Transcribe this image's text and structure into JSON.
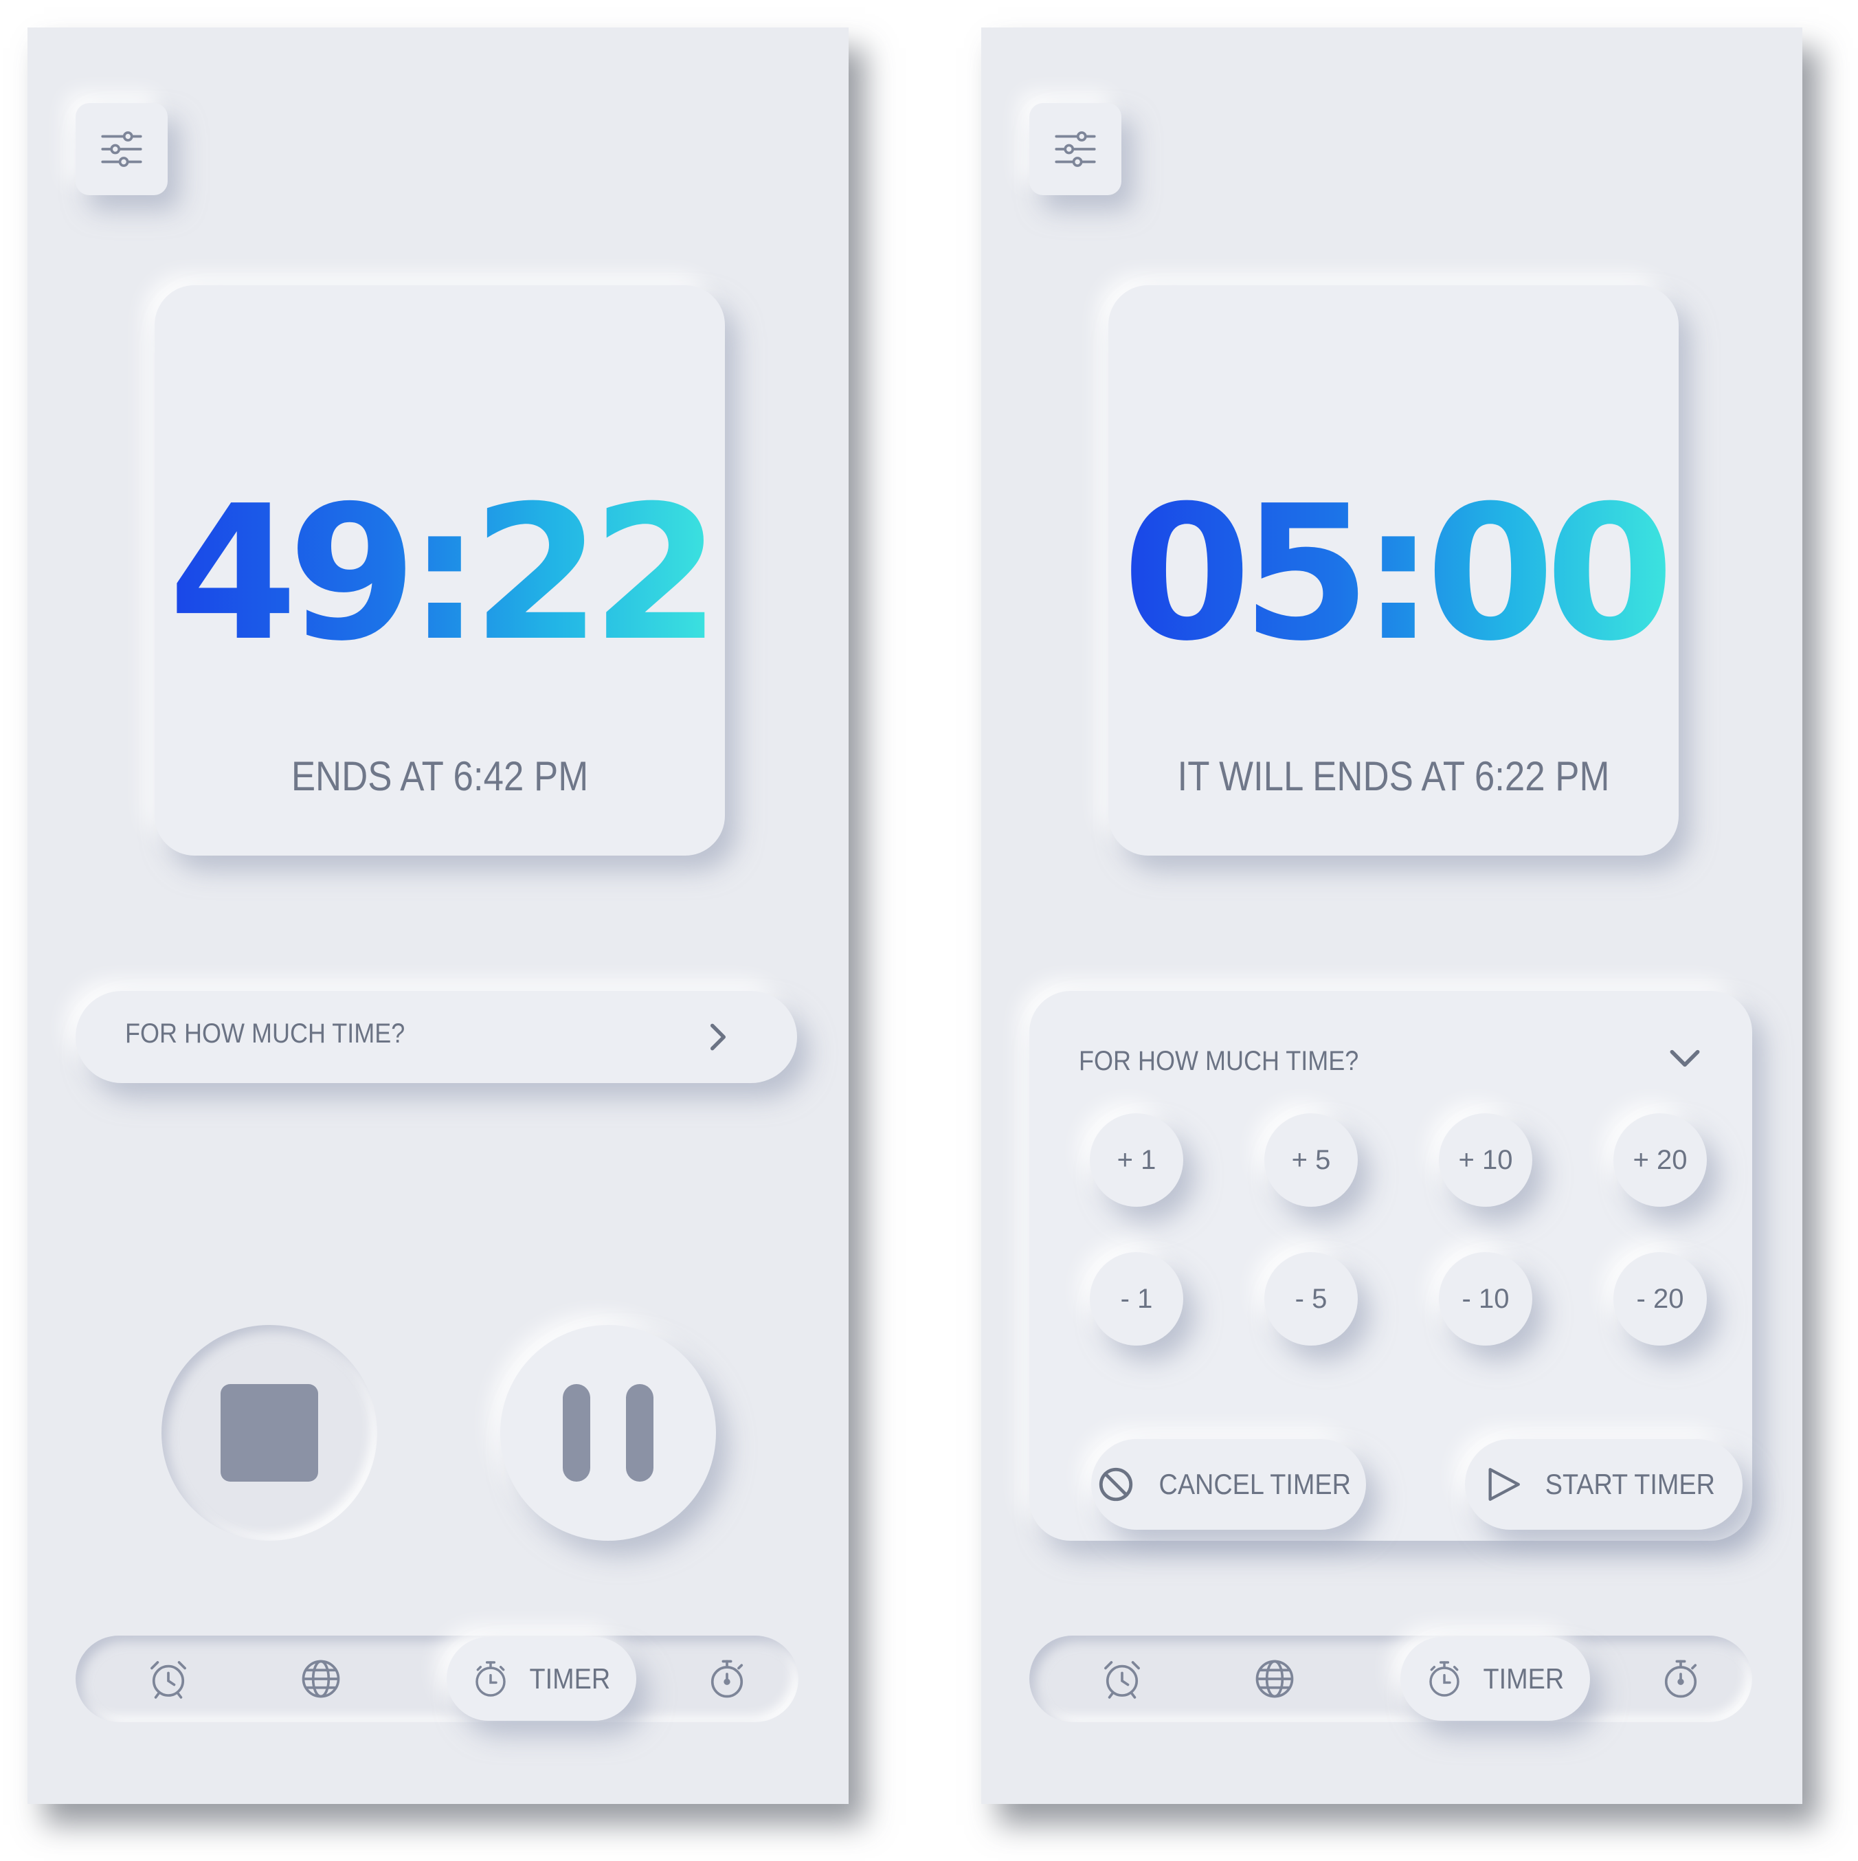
{
  "left_screen": {
    "timer": {
      "minutes": "49",
      "separator": ":",
      "seconds": "22",
      "ends_text": "ENDS AT 6:42 PM"
    },
    "duration_selector": {
      "label": "FOR HOW MUCH TIME?",
      "state": "collapsed"
    },
    "controls": {
      "stop": "stop-icon",
      "pause": "pause-icon"
    },
    "nav": {
      "active": "timer",
      "timer_label": "TIMER",
      "icons": [
        "alarm-clock-icon",
        "globe-icon",
        "timer-icon",
        "stopwatch-icon"
      ]
    }
  },
  "right_screen": {
    "timer": {
      "minutes": "05",
      "separator": ":",
      "seconds": "00",
      "ends_text": "IT WILL ENDS AT 6:22 PM"
    },
    "duration_selector": {
      "label": "FOR HOW MUCH TIME?",
      "state": "expanded",
      "increments": [
        "+ 1",
        "+ 5",
        "+ 10",
        "+ 20"
      ],
      "decrements": [
        "- 1",
        "- 5",
        "- 10",
        "- 20"
      ],
      "cancel_label": "CANCEL TIMER",
      "start_label": "START TIMER"
    },
    "nav": {
      "active": "timer",
      "timer_label": "TIMER",
      "icons": [
        "alarm-clock-icon",
        "globe-icon",
        "timer-icon",
        "stopwatch-icon"
      ]
    }
  },
  "colors": {
    "background": "#e9ebf0",
    "text_muted": "#6b7384",
    "icon": "#8b92a5",
    "gradient_start": "#1a43e8",
    "gradient_end": "#3ee6de"
  }
}
